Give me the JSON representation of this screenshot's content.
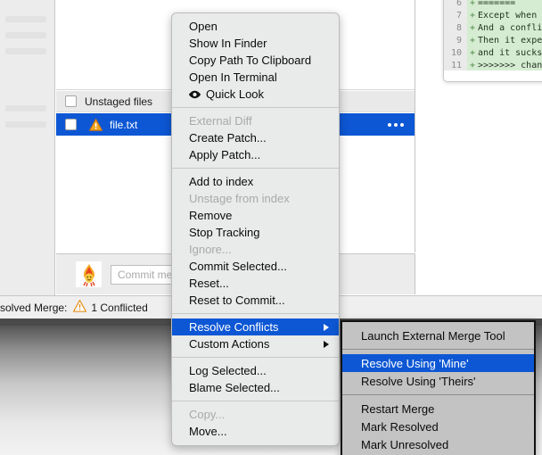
{
  "file_panel": {
    "list_header": {
      "label": "Unstaged files",
      "checkbox_checked": false
    },
    "rows": [
      {
        "name": "file.txt",
        "checkbox_checked": false,
        "status_icon": "warning-triangle-icon",
        "selected": true,
        "overflow_icon": "ellipsis-icon"
      }
    ]
  },
  "commit_bar": {
    "avatar_icon": "flame-avatar-icon",
    "commit_message_value": "",
    "commit_message_placeholder": "Commit message"
  },
  "status_bar": {
    "text": "solved Merge:",
    "warning_icon": "warning-triangle-icon",
    "count_text": "1 Conflicted"
  },
  "code_panel": {
    "lines": [
      {
        "number": "6",
        "sign": "+",
        "text": "======="
      },
      {
        "number": "7",
        "sign": "+",
        "text": "Except when"
      },
      {
        "number": "8",
        "sign": "+",
        "text": "And a confli"
      },
      {
        "number": "9",
        "sign": "+",
        "text": "Then it expe"
      },
      {
        "number": "10",
        "sign": "+",
        "text": "and it sucks"
      },
      {
        "number": "11",
        "sign": "+",
        "text": ">>>>>>> chan"
      }
    ]
  },
  "context_menu": {
    "items": [
      {
        "label": "Open",
        "state": "normal"
      },
      {
        "label": "Show In Finder",
        "state": "normal"
      },
      {
        "label": "Copy Path To Clipboard",
        "state": "normal"
      },
      {
        "label": "Open In Terminal",
        "state": "normal"
      },
      {
        "label": "Quick Look",
        "state": "normal",
        "icon": "eye-icon"
      },
      {
        "separator": true
      },
      {
        "label": "External Diff",
        "state": "disabled"
      },
      {
        "label": "Create Patch...",
        "state": "normal"
      },
      {
        "label": "Apply Patch...",
        "state": "normal"
      },
      {
        "separator": true
      },
      {
        "label": "Add to index",
        "state": "normal"
      },
      {
        "label": "Unstage from index",
        "state": "disabled"
      },
      {
        "label": "Remove",
        "state": "normal"
      },
      {
        "label": "Stop Tracking",
        "state": "normal"
      },
      {
        "label": "Ignore...",
        "state": "disabled"
      },
      {
        "label": "Commit Selected...",
        "state": "normal"
      },
      {
        "label": "Reset...",
        "state": "normal"
      },
      {
        "label": "Reset to Commit...",
        "state": "normal"
      },
      {
        "separator": true
      },
      {
        "label": "Resolve Conflicts",
        "state": "selected",
        "submenu": true
      },
      {
        "label": "Custom Actions",
        "state": "normal",
        "submenu": true
      },
      {
        "separator": true
      },
      {
        "label": "Log Selected...",
        "state": "normal"
      },
      {
        "label": "Blame Selected...",
        "state": "normal"
      },
      {
        "separator": true
      },
      {
        "label": "Copy...",
        "state": "disabled"
      },
      {
        "label": "Move...",
        "state": "normal"
      }
    ]
  },
  "submenu": {
    "items": [
      {
        "label": "Launch External Merge Tool",
        "state": "normal"
      },
      {
        "separator": true
      },
      {
        "label": "Resolve Using 'Mine'",
        "state": "selected"
      },
      {
        "label": "Resolve Using 'Theirs'",
        "state": "normal"
      },
      {
        "separator": true
      },
      {
        "label": "Restart Merge",
        "state": "normal"
      },
      {
        "label": "Mark Resolved",
        "state": "normal"
      },
      {
        "label": "Mark Unresolved",
        "state": "normal"
      }
    ]
  },
  "colors": {
    "selection_blue": "#0d57d4",
    "menu_bg": "#e9eaea",
    "submenu_bg": "#c3c3c3",
    "diff_added_bg": "#d6ecd2",
    "warning_orange": "#e8921f"
  }
}
